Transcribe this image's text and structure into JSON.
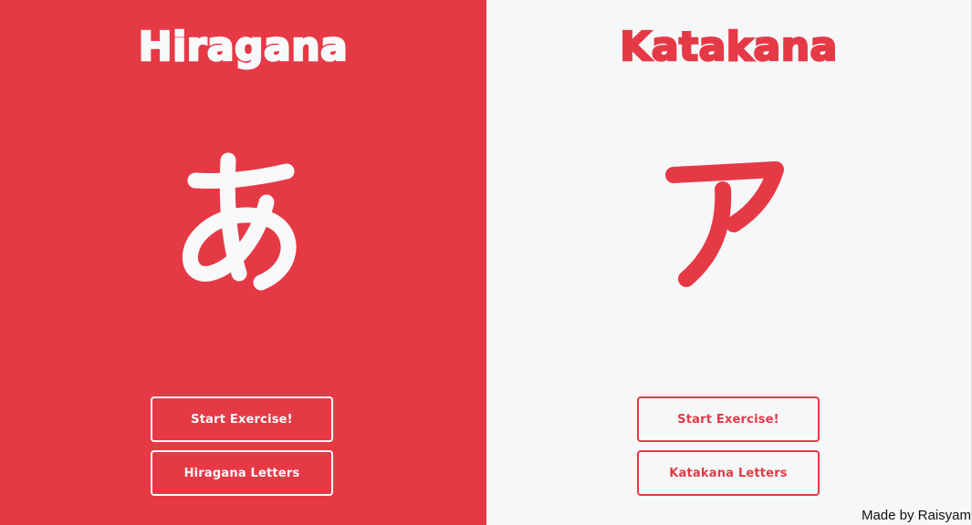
{
  "hiragana": {
    "title": "Hiragana",
    "character": "あ",
    "start_button": "Start Exercise!",
    "letters_button": "Hiragana Letters"
  },
  "katakana": {
    "title": "Katakana",
    "character": "ア",
    "start_button": "Start Exercise!",
    "letters_button": "Katakana Letters"
  },
  "footer": {
    "credit": "Made by Raisyam"
  },
  "colors": {
    "accent": "#e63946",
    "light": "#f8f9fa"
  }
}
